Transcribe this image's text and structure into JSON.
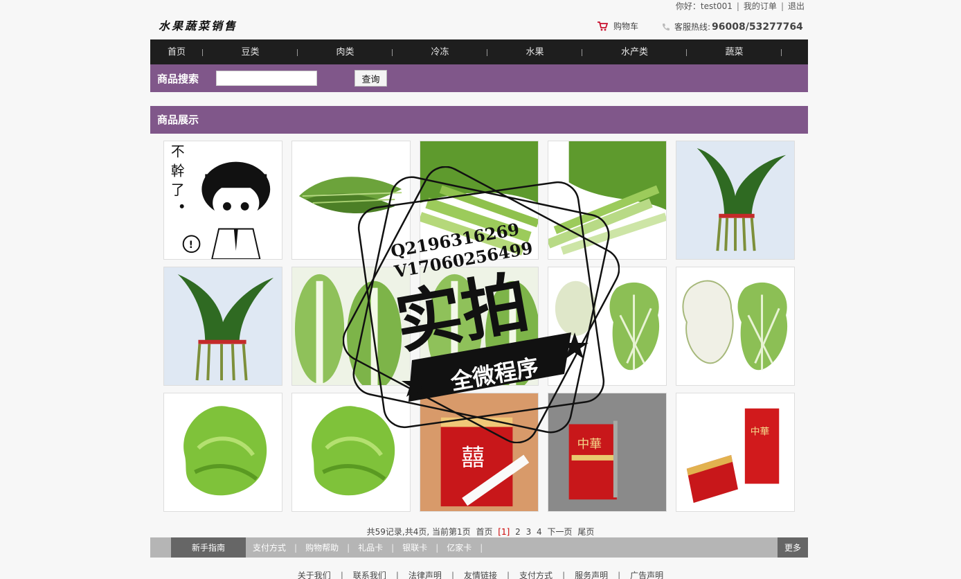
{
  "topbar": {
    "greeting": "你好：test001",
    "orders": "我的订单",
    "logout": "退出"
  },
  "header": {
    "logo": "水果蔬菜销售",
    "cart": "购物车",
    "hotline_label": "客服热线:",
    "hotline_number": "96008/53277764"
  },
  "nav": {
    "items": [
      "首页",
      "豆类",
      "肉类",
      "冷冻",
      "水果",
      "水产类",
      "蔬菜"
    ]
  },
  "search": {
    "title": "商品搜索",
    "input_value": "",
    "button": "查询"
  },
  "products": {
    "title": "商品展示",
    "items": [
      {
        "image": "cartoon-refuse"
      },
      {
        "image": "green-vegetable"
      },
      {
        "image": "celery"
      },
      {
        "image": "celery"
      },
      {
        "image": "chives"
      },
      {
        "image": "chives"
      },
      {
        "image": "napa-cabbage"
      },
      {
        "image": "napa-cabbage"
      },
      {
        "image": "cauliflower"
      },
      {
        "image": "cauliflower"
      },
      {
        "image": "lettuce"
      },
      {
        "image": "lettuce"
      },
      {
        "image": "cigarette-pack"
      },
      {
        "image": "cigarette-pack"
      },
      {
        "image": "cigarette-pack"
      }
    ]
  },
  "watermark": {
    "line1": "Q2196316269",
    "line2": "V17060256499",
    "main": "实拍",
    "banner": "全微程序"
  },
  "pager": {
    "summary": "共59记录,共4页, 当前第1页",
    "first": "首页",
    "current": "[1]",
    "p2": "2",
    "p3": "3",
    "p4": "4",
    "next": "下一页",
    "last": "尾页"
  },
  "footer": {
    "active": "新手指南",
    "links": [
      "支付方式",
      "购物帮助",
      "礼品卡",
      "银联卡",
      "亿家卡"
    ],
    "more": "更多",
    "bottom": [
      "关于我们",
      "联系我们",
      "法律声明",
      "友情链接",
      "支付方式",
      "服务声明",
      "广告声明"
    ]
  },
  "colors": {
    "purple": "#80578a",
    "nav_bg": "#1e1e1e",
    "footer_bg": "#b5b5b5"
  }
}
